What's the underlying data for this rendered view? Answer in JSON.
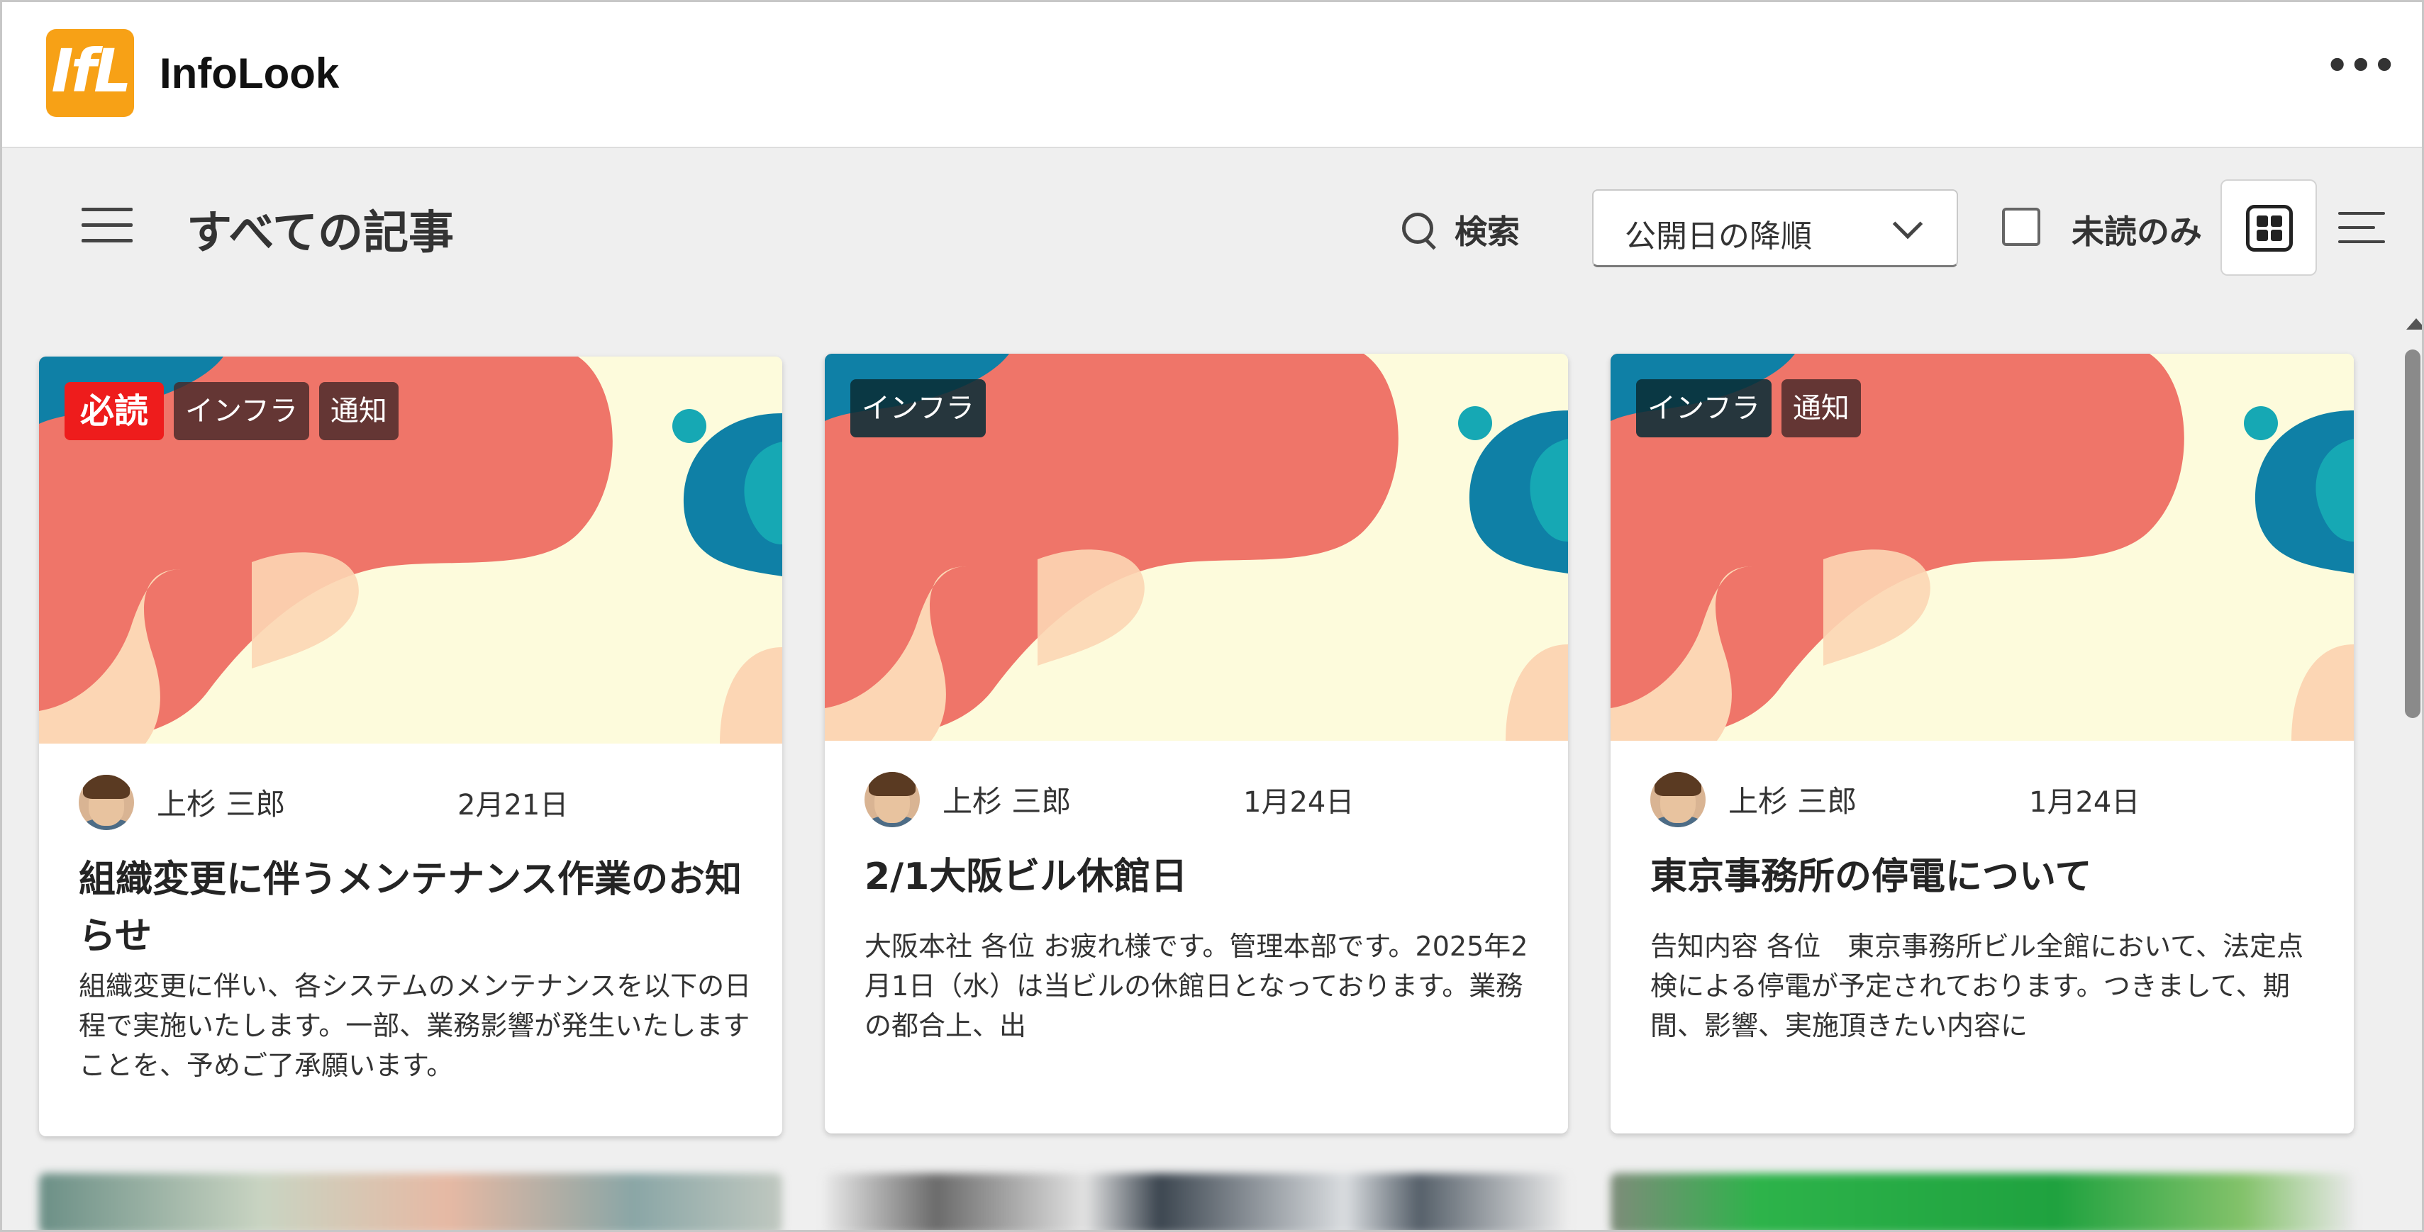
{
  "app": {
    "logo_text": "IfL",
    "title": "InfoLook",
    "more_label": "•••"
  },
  "toolbar": {
    "page_title": "すべての記事",
    "search_label": "検索",
    "sort_selected": "公開日の降順",
    "unread_label": "未読のみ"
  },
  "articles": [
    {
      "tags": [
        "必読",
        "インフラ",
        "通知"
      ],
      "author": "上杉 三郎",
      "date": "2月21日",
      "title": "組織変更に伴うメンテナンス作業のお知らせ",
      "excerpt": "組織変更に伴い、各システムのメンテナンスを以下の日程で実施いたします。一部、業務影響が発生いたしますことを、予めご了承願います。"
    },
    {
      "tags": [
        "インフラ"
      ],
      "author": "上杉 三郎",
      "date": "1月24日",
      "title": "2/1大阪ビル休館日",
      "excerpt": "大阪本社 各位 お疲れ様です。管理本部です。2025年2月1日（水）は当ビルの休館日となっております。業務の都合上、出"
    },
    {
      "tags": [
        "インフラ",
        "通知"
      ],
      "author": "上杉 三郎",
      "date": "1月24日",
      "title": "東京事務所の停電について",
      "excerpt": "告知内容 各位　東京事務所ビル全館において、法定点検による停電が予定されております。つきまして、期間、影響、実施頂きたい内容に"
    }
  ],
  "colors": {
    "accent_orange": "#f7a116",
    "must_read_red": "#ee1c1c",
    "banner_cream": "#fdfbdc",
    "banner_coral": "#ef7569",
    "banner_peach": "#fcd6b4",
    "banner_teal": "#0f80a6"
  }
}
